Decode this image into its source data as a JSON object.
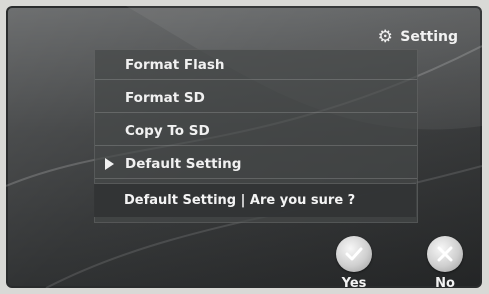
{
  "header": {
    "title": "Setting",
    "icon": "gear-icon"
  },
  "menu": {
    "items": [
      {
        "label": "Format Flash",
        "selected": false
      },
      {
        "label": "Format SD",
        "selected": false
      },
      {
        "label": "Copy To SD",
        "selected": false
      },
      {
        "label": "Default Setting",
        "selected": true
      }
    ],
    "confirm_prompt": "Default Setting | Are you sure ?"
  },
  "buttons": {
    "yes": {
      "label": "Yes",
      "icon": "check-icon"
    },
    "no": {
      "label": "No",
      "icon": "close-icon"
    }
  },
  "colors": {
    "text": "#f1f1f1",
    "panel": "#464849",
    "background": "#3e4041"
  }
}
